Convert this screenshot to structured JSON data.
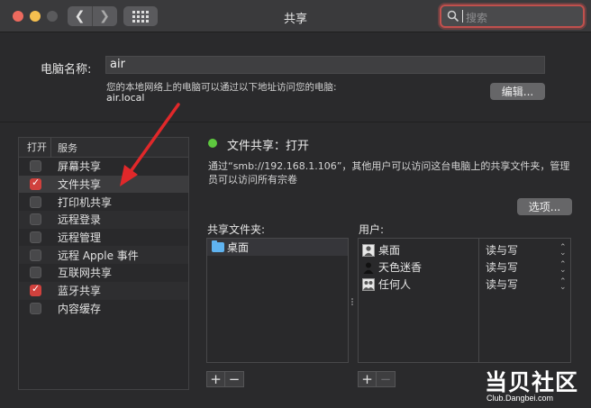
{
  "window": {
    "title": "共享",
    "search_placeholder": "搜索"
  },
  "computer": {
    "name_label": "电脑名称:",
    "name_value": "air",
    "address_note": "您的本地网络上的电脑可以通过以下地址访问您的电脑:",
    "hostname": "air.local",
    "edit_button": "编辑..."
  },
  "services": {
    "header_on": "打开",
    "header_service": "服务",
    "items": [
      {
        "label": "屏幕共享",
        "checked": false
      },
      {
        "label": "文件共享",
        "checked": true,
        "selected": true
      },
      {
        "label": "打印机共享",
        "checked": false
      },
      {
        "label": "远程登录",
        "checked": false
      },
      {
        "label": "远程管理",
        "checked": false
      },
      {
        "label": "远程 Apple 事件",
        "checked": false
      },
      {
        "label": "互联网共享",
        "checked": false
      },
      {
        "label": "蓝牙共享",
        "checked": true
      },
      {
        "label": "内容缓存",
        "checked": false
      }
    ]
  },
  "detail": {
    "status": "文件共享：打开",
    "status_color": "#5ec93f",
    "description": "通过“smb://192.168.1.106”，其他用户可以访问这台电脑上的共享文件夹，管理员可以访问所有宗卷",
    "options_button": "选项...",
    "shared_folders_label": "共享文件夹:",
    "users_label": "用户:",
    "folders": [
      {
        "name": "桌面"
      }
    ],
    "users": [
      {
        "name": "桌面",
        "icon": "single-user-icon",
        "permission": "读与写"
      },
      {
        "name": "天色迷香",
        "icon": "person-silhouette-icon",
        "permission": "读与写"
      },
      {
        "name": "任何人",
        "icon": "group-users-icon",
        "permission": "读与写"
      }
    ],
    "add_symbol": "+",
    "remove_symbol": "−"
  },
  "watermark": {
    "main": "当贝社区",
    "sub": "Club.Dangbei.com"
  },
  "colors": {
    "accent_red": "#d0413d",
    "annotation_arrow": "#e0282a"
  }
}
